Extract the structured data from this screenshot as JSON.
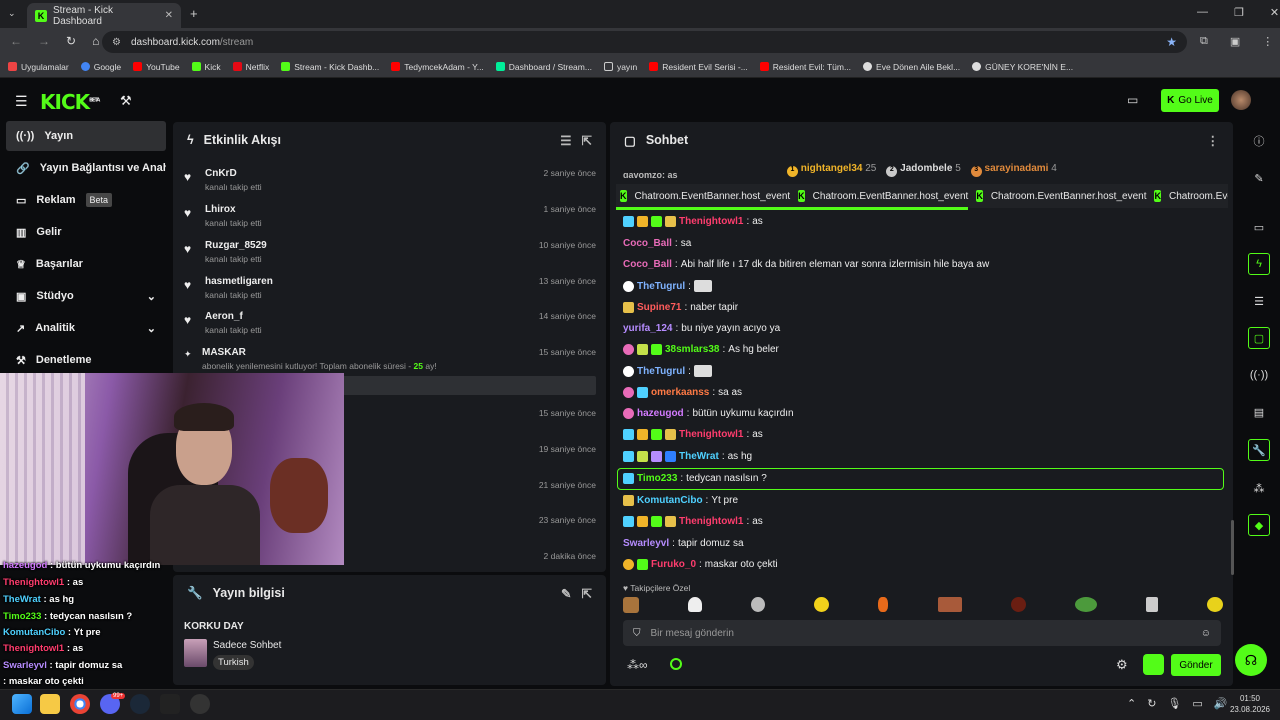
{
  "browser": {
    "tab_title": "Stream - Kick Dashboard",
    "url_host": "dashboard.kick.com",
    "url_path": "/stream",
    "bookmarks": [
      "Uygulamalar",
      "Google",
      "YouTube",
      "Kick",
      "Netflix",
      "Stream - Kick Dashb...",
      "TedymcekAdam - Y...",
      "Dashboard / Stream...",
      "yayın",
      "Resident Evil Serisi -...",
      "Resident Evil: Tüm...",
      "Eve Dönen Aile Bekl...",
      "GÜNEY KORE'NİN E..."
    ]
  },
  "header": {
    "logo": "KICK",
    "logo_beta": "BETA",
    "go_live": "Go Live"
  },
  "sidebar": {
    "items": [
      {
        "label": "Yayın"
      },
      {
        "label": "Yayın Bağlantısı ve Anahtarı"
      },
      {
        "label": "Reklam",
        "badge": "Beta"
      },
      {
        "label": "Gelir"
      },
      {
        "label": "Başarılar"
      },
      {
        "label": "Stüdyo"
      },
      {
        "label": "Analitik"
      },
      {
        "label": "Denetleme"
      }
    ]
  },
  "activity": {
    "title": "Etkinlik Akışı",
    "events": [
      {
        "name": "CnKrD",
        "sub": "kanalı takip etti",
        "time": "2 saniye önce"
      },
      {
        "name": "Lhirox",
        "sub": "kanalı takip etti",
        "time": "1 saniye önce"
      },
      {
        "name": "Ruzgar_8529",
        "sub": "kanalı takip etti",
        "time": "10 saniye önce"
      },
      {
        "name": "hasmetligaren",
        "sub": "kanalı takip etti",
        "time": "13 saniye önce"
      },
      {
        "name": "Aeron_f",
        "sub": "kanalı takip etti",
        "time": "14 saniye önce"
      },
      {
        "name": "MASKAR",
        "sub": "abonelik yenilemesini kutluyor! Toplam abonelik süresi -",
        "sub_num": "25",
        "sub_end": "ay!",
        "time": "15 saniye önce"
      }
    ],
    "extra_times": [
      "15 saniye önce",
      "19 saniye önce",
      "21 saniye önce",
      "23 saniye önce",
      "2 dakika önce"
    ]
  },
  "stream_info": {
    "title": "Yayın bilgisi",
    "stream_title": "KORKU DAY",
    "category": "Sadece Sohbet",
    "tag": "Turkish"
  },
  "chat": {
    "title": "Sohbet",
    "leaderboard": [
      {
        "name": "nightangel34",
        "count": "25",
        "color": "#f0b429"
      },
      {
        "name": "Jadombele",
        "count": "5",
        "color": "#c9c9c9"
      },
      {
        "name": "sarayinadami",
        "count": "4",
        "color": "#e08a3c"
      }
    ],
    "host_event": "Chatroom.EventBanner.host_event",
    "host_event_partial": "Chatroom.Event",
    "top_partial": "davomzo: as",
    "messages": [
      {
        "user": "Thenightowl1",
        "text": "as",
        "color": "#ff3d6e"
      },
      {
        "user": "Coco_Ball",
        "text": "sa",
        "color": "#e86bb8"
      },
      {
        "user": "Coco_Ball",
        "text": "Abi half life ı 17 dk da bitiren eleman var sonra izlermisin hile baya aw",
        "color": "#e86bb8"
      },
      {
        "user": "TheTugrul",
        "text": "",
        "color": "#7fb3ff"
      },
      {
        "user": "Supine71",
        "text": "naber tapir",
        "color": "#ff5c5c"
      },
      {
        "user": "yurifa_124",
        "text": "bu niye yayın acıyo ya",
        "color": "#b68cff"
      },
      {
        "user": "38smlars38",
        "text": "As hg beler",
        "color": "#53fc18"
      },
      {
        "user": "TheTugrul",
        "text": "",
        "color": "#7fb3ff"
      },
      {
        "user": "omerkaanss",
        "text": "sa as",
        "color": "#ff7a45"
      },
      {
        "user": "hazeugod",
        "text": "bütün uykumu kaçırdın",
        "color": "#d37bff"
      },
      {
        "user": "Thenightowl1",
        "text": "as",
        "color": "#ff3d6e"
      },
      {
        "user": "TheWrat",
        "text": "as hg",
        "color": "#4fd1ff"
      },
      {
        "user": "Timo233",
        "text": "tedycan nasılsın ?",
        "color": "#53fc18"
      },
      {
        "user": "KomutanCibo",
        "text": "Yt pre",
        "color": "#4fd1ff"
      },
      {
        "user": "Thenightowl1",
        "text": "as",
        "color": "#ff3d6e"
      },
      {
        "user": "Swarleyvl",
        "text": "tapir domuz sa",
        "color": "#b68cff"
      },
      {
        "user": "Furuko_0",
        "text": "maskar oto çekti",
        "color": "#ff3d6e"
      }
    ],
    "emote_label": "Takipçilere Özel",
    "input_placeholder": "Bir mesaj gönderin",
    "send": "Gönder"
  },
  "overlay_chat": [
    {
      "user": "hazeugod",
      "text": "bütün uykumu kaçırdın"
    },
    {
      "user": "Thenightowl1",
      "text": "as"
    },
    {
      "user": "TheWrat",
      "text": "as hg"
    },
    {
      "user": "Timo233",
      "text": "tedycan nasılsın ?"
    },
    {
      "user": "KomutanCibo",
      "text": "Yt pre"
    },
    {
      "user": "Thenightowl1",
      "text": "as"
    },
    {
      "user": "Swarleyvl",
      "text": "tapir domuz sa"
    },
    {
      "user": "",
      "text": "maskar oto çekti"
    }
  ],
  "taskbar": {
    "time": "01:50",
    "date": "23.08.2026",
    "notif_badge": "99+"
  },
  "colors": {
    "accent": "#53fc18",
    "panel": "#191b1f",
    "bg": "#0b0c0e"
  }
}
